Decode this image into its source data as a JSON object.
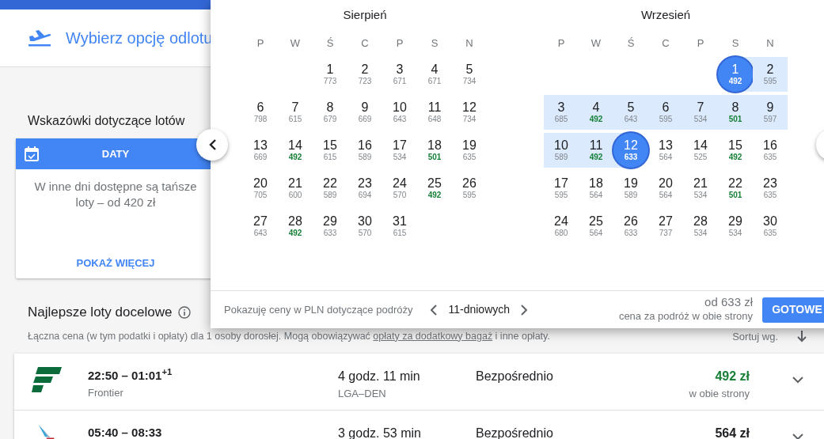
{
  "header": {
    "title": "Wybierz opcję odlotu"
  },
  "tips": {
    "heading": "Wskazówki dotyczące lotów",
    "card": {
      "label": "DATY",
      "text": "W inne dni dostępne są tańsze loty – od 420 zł",
      "action": "POKAŻ WIĘCEJ"
    }
  },
  "results": {
    "heading": "Najlepsze loty docelowe",
    "note": "Łączna cena (w tym podatki i opłaty) dla 1 osoby dorosłej. Mogą obowiązywać ",
    "note_link": "opłaty za dodatkowy bagaż",
    "note_end": " i inne opłaty.",
    "sort_label": "Sortuj wg."
  },
  "flights": [
    {
      "kind": "stripes",
      "times": "22:50 – 01:01$^{+1}$",
      "airline": "Frontier",
      "duration": "4 godz. 11 min",
      "route": "LGA–DEN",
      "stops": "Bezpośrednio",
      "price": "492 zł",
      "cheapest": true,
      "price_note": "w obie strony"
    },
    {
      "kind": "tail",
      "times": "05:40 – 08:33",
      "duration": "3 godz. 53 min",
      "stops": "Bezpośrednio",
      "price": "564 zł",
      "cheapest": false
    }
  ],
  "date_picker": {
    "months": [
      {
        "title": "Sierpień",
        "weekdays": [
          "P",
          "W",
          "Ś",
          "C",
          "P",
          "S",
          "N"
        ],
        "weeks": [
          [
            {
              "kind": "blank"
            },
            {
              "kind": "blank"
            },
            {
              "kind": "day",
              "day": "1",
              "price": "773",
              "cheap": false,
              "in_range": false,
              "selected": false
            },
            {
              "kind": "day",
              "day": "2",
              "price": "723",
              "cheap": false,
              "in_range": false,
              "selected": false
            },
            {
              "kind": "day",
              "day": "3",
              "price": "671",
              "cheap": false,
              "in_range": false,
              "selected": false
            },
            {
              "kind": "day",
              "day": "4",
              "price": "671",
              "cheap": false,
              "in_range": false,
              "selected": false
            },
            {
              "kind": "day",
              "day": "5",
              "price": "734",
              "cheap": false,
              "in_range": false,
              "selected": false
            }
          ],
          [
            {
              "kind": "day",
              "day": "6",
              "price": "798",
              "cheap": false,
              "in_range": false,
              "selected": false
            },
            {
              "kind": "day",
              "day": "7",
              "price": "615",
              "cheap": false,
              "in_range": false,
              "selected": false
            },
            {
              "kind": "day",
              "day": "8",
              "price": "679",
              "cheap": false,
              "in_range": false,
              "selected": false
            },
            {
              "kind": "day",
              "day": "9",
              "price": "669",
              "cheap": false,
              "in_range": false,
              "selected": false
            },
            {
              "kind": "day",
              "day": "10",
              "price": "643",
              "cheap": false,
              "in_range": false,
              "selected": false
            },
            {
              "kind": "day",
              "day": "11",
              "price": "648",
              "cheap": false,
              "in_range": false,
              "selected": false
            },
            {
              "kind": "day",
              "day": "12",
              "price": "734",
              "cheap": false,
              "in_range": false,
              "selected": false
            }
          ],
          [
            {
              "kind": "day",
              "day": "13",
              "price": "669",
              "cheap": false,
              "in_range": false,
              "selected": false
            },
            {
              "kind": "day",
              "day": "14",
              "price": "492",
              "cheap": true,
              "in_range": false,
              "selected": false
            },
            {
              "kind": "day",
              "day": "15",
              "price": "615",
              "cheap": false,
              "in_range": false,
              "selected": false
            },
            {
              "kind": "day",
              "day": "16",
              "price": "589",
              "cheap": false,
              "in_range": false,
              "selected": false
            },
            {
              "kind": "day",
              "day": "17",
              "price": "534",
              "cheap": false,
              "in_range": false,
              "selected": false
            },
            {
              "kind": "day",
              "day": "18",
              "price": "501",
              "cheap": true,
              "in_range": false,
              "selected": false
            },
            {
              "kind": "day",
              "day": "19",
              "price": "635",
              "cheap": false,
              "in_range": false,
              "selected": false
            }
          ],
          [
            {
              "kind": "day",
              "day": "20",
              "price": "705",
              "cheap": false,
              "in_range": false,
              "selected": false
            },
            {
              "kind": "day",
              "day": "21",
              "price": "600",
              "cheap": false,
              "in_range": false,
              "selected": false
            },
            {
              "kind": "day",
              "day": "22",
              "price": "589",
              "cheap": false,
              "in_range": false,
              "selected": false
            },
            {
              "kind": "day",
              "day": "23",
              "price": "694",
              "cheap": false,
              "in_range": false,
              "selected": false
            },
            {
              "kind": "day",
              "day": "24",
              "price": "570",
              "cheap": false,
              "in_range": false,
              "selected": false
            },
            {
              "kind": "day",
              "day": "25",
              "price": "492",
              "cheap": true,
              "in_range": false,
              "selected": false
            },
            {
              "kind": "day",
              "day": "26",
              "price": "595",
              "cheap": false,
              "in_range": false,
              "selected": false
            }
          ],
          [
            {
              "kind": "day",
              "day": "27",
              "price": "643",
              "cheap": false,
              "in_range": false,
              "selected": false
            },
            {
              "kind": "day",
              "day": "28",
              "price": "492",
              "cheap": true,
              "in_range": false,
              "selected": false
            },
            {
              "kind": "day",
              "day": "29",
              "price": "633",
              "cheap": false,
              "in_range": false,
              "selected": false
            },
            {
              "kind": "day",
              "day": "30",
              "price": "570",
              "cheap": false,
              "in_range": false,
              "selected": false
            },
            {
              "kind": "day",
              "day": "31",
              "price": "615",
              "cheap": false,
              "in_range": false,
              "selected": false
            }
          ]
        ]
      },
      {
        "title": "Wrzesień",
        "weekdays": [
          "P",
          "W",
          "Ś",
          "C",
          "P",
          "S",
          "N"
        ],
        "weeks": [
          [
            {
              "kind": "blank"
            },
            {
              "kind": "blank"
            },
            {
              "kind": "blank"
            },
            {
              "kind": "blank"
            },
            {
              "kind": "blank"
            },
            {
              "kind": "day",
              "day": "1",
              "price": "492",
              "cheap": true,
              "in_range": true,
              "selected": true
            },
            {
              "kind": "day",
              "day": "2",
              "price": "595",
              "cheap": false,
              "in_range": true,
              "selected": false
            }
          ],
          [
            {
              "kind": "day",
              "day": "3",
              "price": "685",
              "cheap": false,
              "in_range": true,
              "selected": false
            },
            {
              "kind": "day",
              "day": "4",
              "price": "492",
              "cheap": true,
              "in_range": true,
              "selected": false
            },
            {
              "kind": "day",
              "day": "5",
              "price": "643",
              "cheap": false,
              "in_range": true,
              "selected": false
            },
            {
              "kind": "day",
              "day": "6",
              "price": "595",
              "cheap": false,
              "in_range": true,
              "selected": false
            },
            {
              "kind": "day",
              "day": "7",
              "price": "534",
              "cheap": false,
              "in_range": true,
              "selected": false
            },
            {
              "kind": "day",
              "day": "8",
              "price": "501",
              "cheap": true,
              "in_range": true,
              "selected": false
            },
            {
              "kind": "day",
              "day": "9",
              "price": "597",
              "cheap": false,
              "in_range": true,
              "selected": false
            }
          ],
          [
            {
              "kind": "day",
              "day": "10",
              "price": "589",
              "cheap": false,
              "in_range": true,
              "selected": false
            },
            {
              "kind": "day",
              "day": "11",
              "price": "492",
              "cheap": true,
              "in_range": true,
              "selected": false
            },
            {
              "kind": "day",
              "day": "12",
              "price": "633",
              "cheap": false,
              "in_range": true,
              "selected": true
            },
            {
              "kind": "day",
              "day": "13",
              "price": "564",
              "cheap": false,
              "in_range": false,
              "selected": false
            },
            {
              "kind": "day",
              "day": "14",
              "price": "525",
              "cheap": false,
              "in_range": false,
              "selected": false
            },
            {
              "kind": "day",
              "day": "15",
              "price": "492",
              "cheap": true,
              "in_range": false,
              "selected": false
            },
            {
              "kind": "day",
              "day": "16",
              "price": "635",
              "cheap": false,
              "in_range": false,
              "selected": false
            }
          ],
          [
            {
              "kind": "day",
              "day": "17",
              "price": "595",
              "cheap": false,
              "in_range": false,
              "selected": false
            },
            {
              "kind": "day",
              "day": "18",
              "price": "564",
              "cheap": false,
              "in_range": false,
              "selected": false
            },
            {
              "kind": "day",
              "day": "19",
              "price": "589",
              "cheap": false,
              "in_range": false,
              "selected": false
            },
            {
              "kind": "day",
              "day": "20",
              "price": "564",
              "cheap": false,
              "in_range": false,
              "selected": false
            },
            {
              "kind": "day",
              "day": "21",
              "price": "534",
              "cheap": false,
              "in_range": false,
              "selected": false
            },
            {
              "kind": "day",
              "day": "22",
              "price": "501",
              "cheap": true,
              "in_range": false,
              "selected": false
            },
            {
              "kind": "day",
              "day": "23",
              "price": "635",
              "cheap": false,
              "in_range": false,
              "selected": false
            }
          ],
          [
            {
              "kind": "day",
              "day": "24",
              "price": "680",
              "cheap": false,
              "in_range": false,
              "selected": false
            },
            {
              "kind": "day",
              "day": "25",
              "price": "564",
              "cheap": false,
              "in_range": false,
              "selected": false
            },
            {
              "kind": "day",
              "day": "26",
              "price": "633",
              "cheap": false,
              "in_range": false,
              "selected": false
            },
            {
              "kind": "day",
              "day": "27",
              "price": "737",
              "cheap": false,
              "in_range": false,
              "selected": false
            },
            {
              "kind": "day",
              "day": "28",
              "price": "534",
              "cheap": false,
              "in_range": false,
              "selected": false
            },
            {
              "kind": "day",
              "day": "29",
              "price": "534",
              "cheap": false,
              "in_range": false,
              "selected": false
            },
            {
              "kind": "day",
              "day": "30",
              "price": "635",
              "cheap": false,
              "in_range": false,
              "selected": false
            }
          ]
        ]
      }
    ],
    "footer": {
      "label": "Pokazuję ceny w PLN dotyczące podróży",
      "duration": "11-dniowych",
      "price": "od 633 zł",
      "price_note": "cena za podróż w obie strony",
      "done": "GOTOWE"
    }
  }
}
